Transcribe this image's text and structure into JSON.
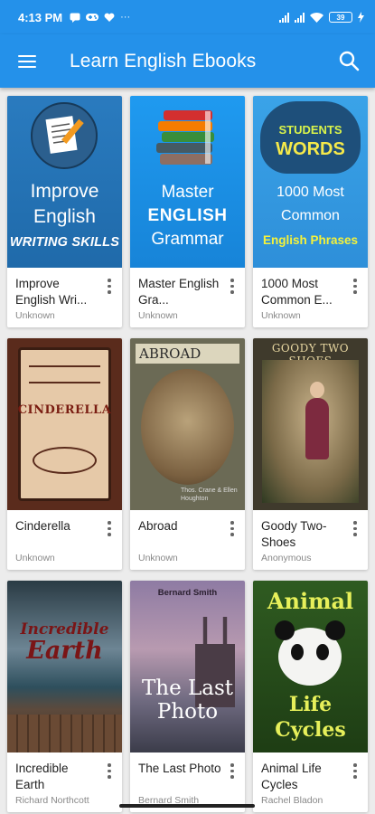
{
  "status": {
    "time": "4:13 PM",
    "battery": "39",
    "overflow": "···"
  },
  "app_bar": {
    "title": "Learn English Ebooks"
  },
  "icons": {
    "menu": "hamburger-icon",
    "search": "search-icon",
    "more": "more-vert-icon"
  },
  "books": [
    {
      "title": "Improve English Wri...",
      "author": "Unknown",
      "cover": {
        "line1": "Improve",
        "line2": "English",
        "line3": "WRITING SKILLS"
      }
    },
    {
      "title": "Master English Gra...",
      "author": "Unknown",
      "cover": {
        "line1": "Master",
        "line2": "ENGLISH",
        "line3": "Grammar"
      }
    },
    {
      "title": "1000 Most Common E...",
      "author": "Unknown",
      "cover": {
        "line1": "1000 Most",
        "line2": "Common",
        "line3": "English Phrases",
        "top1": "STUDENTS",
        "top2": "WORDS"
      }
    },
    {
      "title": "Cinderella",
      "author": "Unknown",
      "cover": {
        "line1": "CINDERELLA"
      }
    },
    {
      "title": "Abroad",
      "author": "Unknown",
      "cover": {
        "line1": "ABROAD",
        "line2": "Thos. Crane & Ellen Houghton"
      }
    },
    {
      "title": "Goody Two-Shoes",
      "author": "Anonymous",
      "cover": {
        "line1": "GOODY TWO SHOES"
      }
    },
    {
      "title": "Incredible Earth",
      "author": "Richard Northcott",
      "cover": {
        "line1": "Incredible",
        "line2": "Earth"
      }
    },
    {
      "title": "The Last Photo",
      "author": "Bernard Smith",
      "cover": {
        "line1": "Bernard Smith",
        "line2": "The Last",
        "line3": "Photo"
      }
    },
    {
      "title": "Animal Life Cycles",
      "author": "Rachel Bladon",
      "cover": {
        "line1": "Animal",
        "line2": "Life",
        "line3": "Cycles"
      }
    }
  ]
}
